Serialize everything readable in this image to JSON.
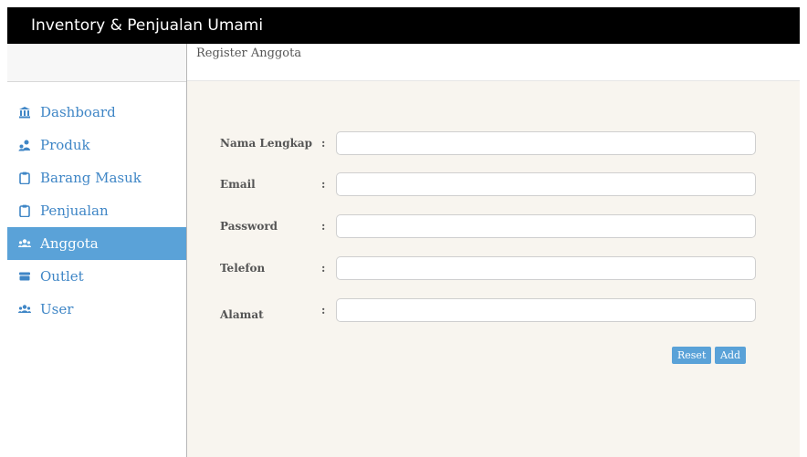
{
  "app": {
    "title": "Inventory & Penjualan Umami"
  },
  "sidebar": {
    "items": [
      {
        "label": "Dashboard",
        "icon": "bank-icon",
        "active": false
      },
      {
        "label": "Produk",
        "icon": "users-icon",
        "active": false
      },
      {
        "label": "Barang Masuk",
        "icon": "clipboard-icon",
        "active": false
      },
      {
        "label": "Penjualan",
        "icon": "clipboard-icon",
        "active": false
      },
      {
        "label": "Anggota",
        "icon": "group-icon",
        "active": true
      },
      {
        "label": "Outlet",
        "icon": "store-icon",
        "active": false
      },
      {
        "label": "User",
        "icon": "group-icon",
        "active": false
      }
    ]
  },
  "main": {
    "title": "Register Anggota",
    "form": {
      "fields": [
        {
          "label": "Nama Lengkap",
          "colon": ":",
          "value": ""
        },
        {
          "label": "Email",
          "colon": ":",
          "value": ""
        },
        {
          "label": "Password",
          "colon": ":",
          "value": ""
        },
        {
          "label": "Telefon",
          "colon": ":",
          "value": ""
        },
        {
          "label": "Alamat",
          "colon": ":",
          "value": ""
        }
      ],
      "reset_label": "Reset",
      "add_label": "Add"
    }
  },
  "colors": {
    "accent": "#5aa2d8",
    "link": "#3f86c6",
    "titlebar_bg": "#000000",
    "content_bg": "#f8f5ef"
  }
}
